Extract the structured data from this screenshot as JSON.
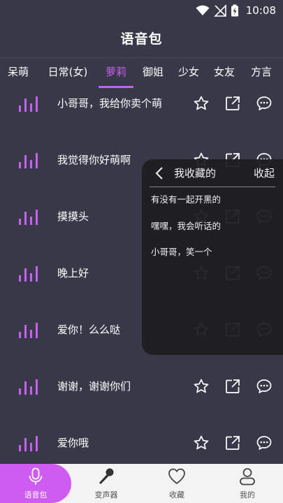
{
  "status_bar": {
    "time": "10:08"
  },
  "header": {
    "title": "语音包"
  },
  "tabs": [
    {
      "label": "呆萌",
      "active": false
    },
    {
      "label": "日常(女)",
      "active": false
    },
    {
      "label": "萝莉",
      "active": true
    },
    {
      "label": "御姐",
      "active": false
    },
    {
      "label": "少女",
      "active": false
    },
    {
      "label": "女友",
      "active": false
    },
    {
      "label": "方言",
      "active": false
    }
  ],
  "voice_list": [
    {
      "label": "小哥哥，我给你卖个萌"
    },
    {
      "label": "我觉得你好萌啊"
    },
    {
      "label": "摸摸头"
    },
    {
      "label": "晚上好"
    },
    {
      "label": "爱你！么么哒"
    },
    {
      "label": "谢谢，谢谢你们"
    },
    {
      "label": "爱你哦"
    }
  ],
  "favorites_panel": {
    "title": "我收藏的",
    "collapse_label": "收起",
    "items": [
      {
        "label": "有没有一起开黑的"
      },
      {
        "label": "嘿嘿，我会听话的"
      },
      {
        "label": "小哥哥，笑一个"
      }
    ]
  },
  "bottom_nav": [
    {
      "label": "语音包",
      "icon": "microphone-icon",
      "active": true
    },
    {
      "label": "变声器",
      "icon": "karaoke-mic-icon",
      "active": false
    },
    {
      "label": "收藏",
      "icon": "heart-icon",
      "active": false
    },
    {
      "label": "我的",
      "icon": "user-icon",
      "active": false
    }
  ],
  "colors": {
    "background": "#393848",
    "accent": "#c561ef",
    "panel": "#1e1e1f",
    "nav_background": "#f3f3f4"
  }
}
